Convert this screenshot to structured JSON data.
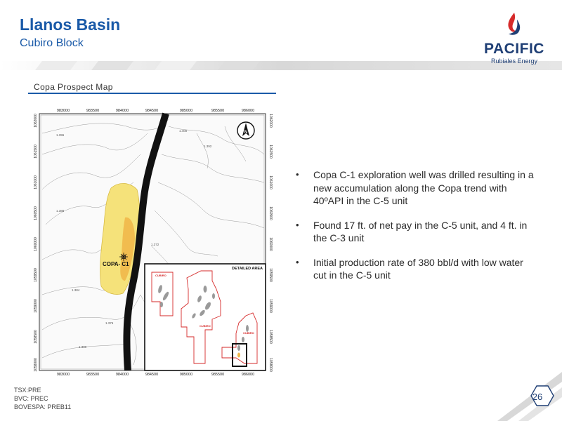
{
  "header": {
    "title": "Llanos Basin",
    "subtitle": "Cubiro Block"
  },
  "logo": {
    "name": "PACIFIC",
    "tagline": "Rubiales Energy",
    "icon": "flame-drop-icon"
  },
  "section": {
    "label": "Copa Prospect Map"
  },
  "map": {
    "x_ticks": [
      "983000",
      "983500",
      "984000",
      "984500",
      "985000",
      "985500",
      "986000"
    ],
    "y_ticks_left": [
      "1062000",
      "1061500",
      "1061000",
      "1060500",
      "1060000",
      "1059500",
      "1059000",
      "1058500",
      "1058000"
    ],
    "y_ticks_right": [
      "1062000",
      "1061500",
      "1061000",
      "1060500",
      "1060000",
      "1059500",
      "1059000",
      "1058500",
      "1058000"
    ],
    "contour_labels": [
      "1.400",
      "1.396",
      "1.392",
      "1.388",
      "1.384",
      "1.380",
      "1.376",
      "1.372"
    ],
    "well_label": "COPA- C1",
    "north_label": "N",
    "inset_title": "DETAILED AREA",
    "inset_labels": [
      "CUBIRO",
      "CUBIRO",
      "CUBIRO"
    ]
  },
  "bullets": [
    "Copa C-1 exploration well was drilled resulting in a new accumulation along the Copa trend with 40ºAPI in the C-5 unit",
    "Found 17 ft. of net pay in the C-5 unit, and 4 ft. in the C-3 unit",
    "Initial production rate of 380 bbl/d with low water cut in the C-5 unit"
  ],
  "footer": {
    "lines": [
      "TSX:PRE",
      "BVC: PREC",
      "BOVESPA: PREB11"
    ]
  },
  "page_number": "26",
  "colors": {
    "title_blue": "#1a5aa8",
    "logo_navy": "#1f3f75",
    "logo_red": "#d62a2a",
    "prospect_yellow": "#f5e27a",
    "prospect_orange": "#f1b84a",
    "block_outline_red": "#d62a2a"
  }
}
